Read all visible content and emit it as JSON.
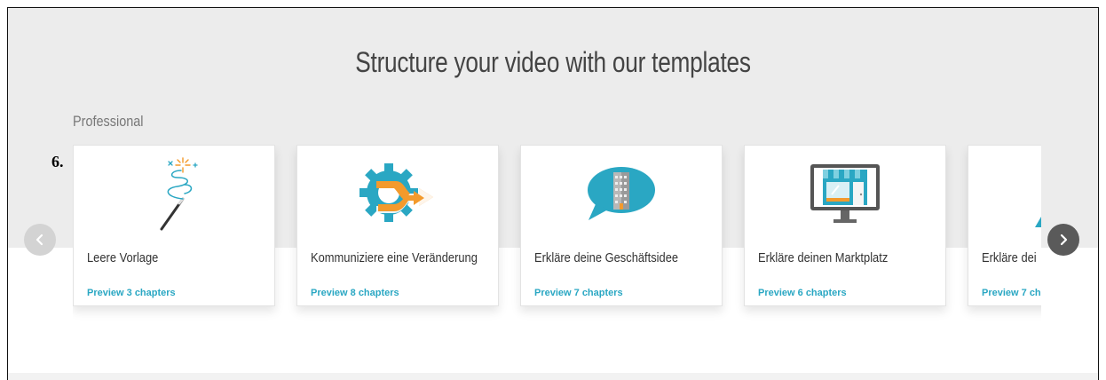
{
  "section": {
    "title": "Structure your video with our templates",
    "category": "Professional",
    "step_marker": "6."
  },
  "templates": [
    {
      "name": "Leere Vorlage",
      "preview": "Preview 3 chapters",
      "icon": "magic-wand-icon"
    },
    {
      "name": "Kommuniziere eine Veränderung",
      "preview": "Preview 8 chapters",
      "icon": "gear-arrows-icon"
    },
    {
      "name": "Erkläre deine Geschäftsidee",
      "preview": "Preview 7 chapters",
      "icon": "building-speech-bubble-icon"
    },
    {
      "name": "Erkläre deinen Marktplatz",
      "preview": "Preview 6 chapters",
      "icon": "storefront-monitor-icon"
    },
    {
      "name": "Erkläre dei",
      "preview": "Preview 7 ch",
      "icon": "partial-icon"
    }
  ],
  "navigation": {
    "prev_icon": "chevron-left-icon",
    "next_icon": "chevron-right-icon"
  },
  "colors": {
    "accent": "#2aa7c3",
    "orange": "#f39a2c",
    "band": "#ececec"
  }
}
